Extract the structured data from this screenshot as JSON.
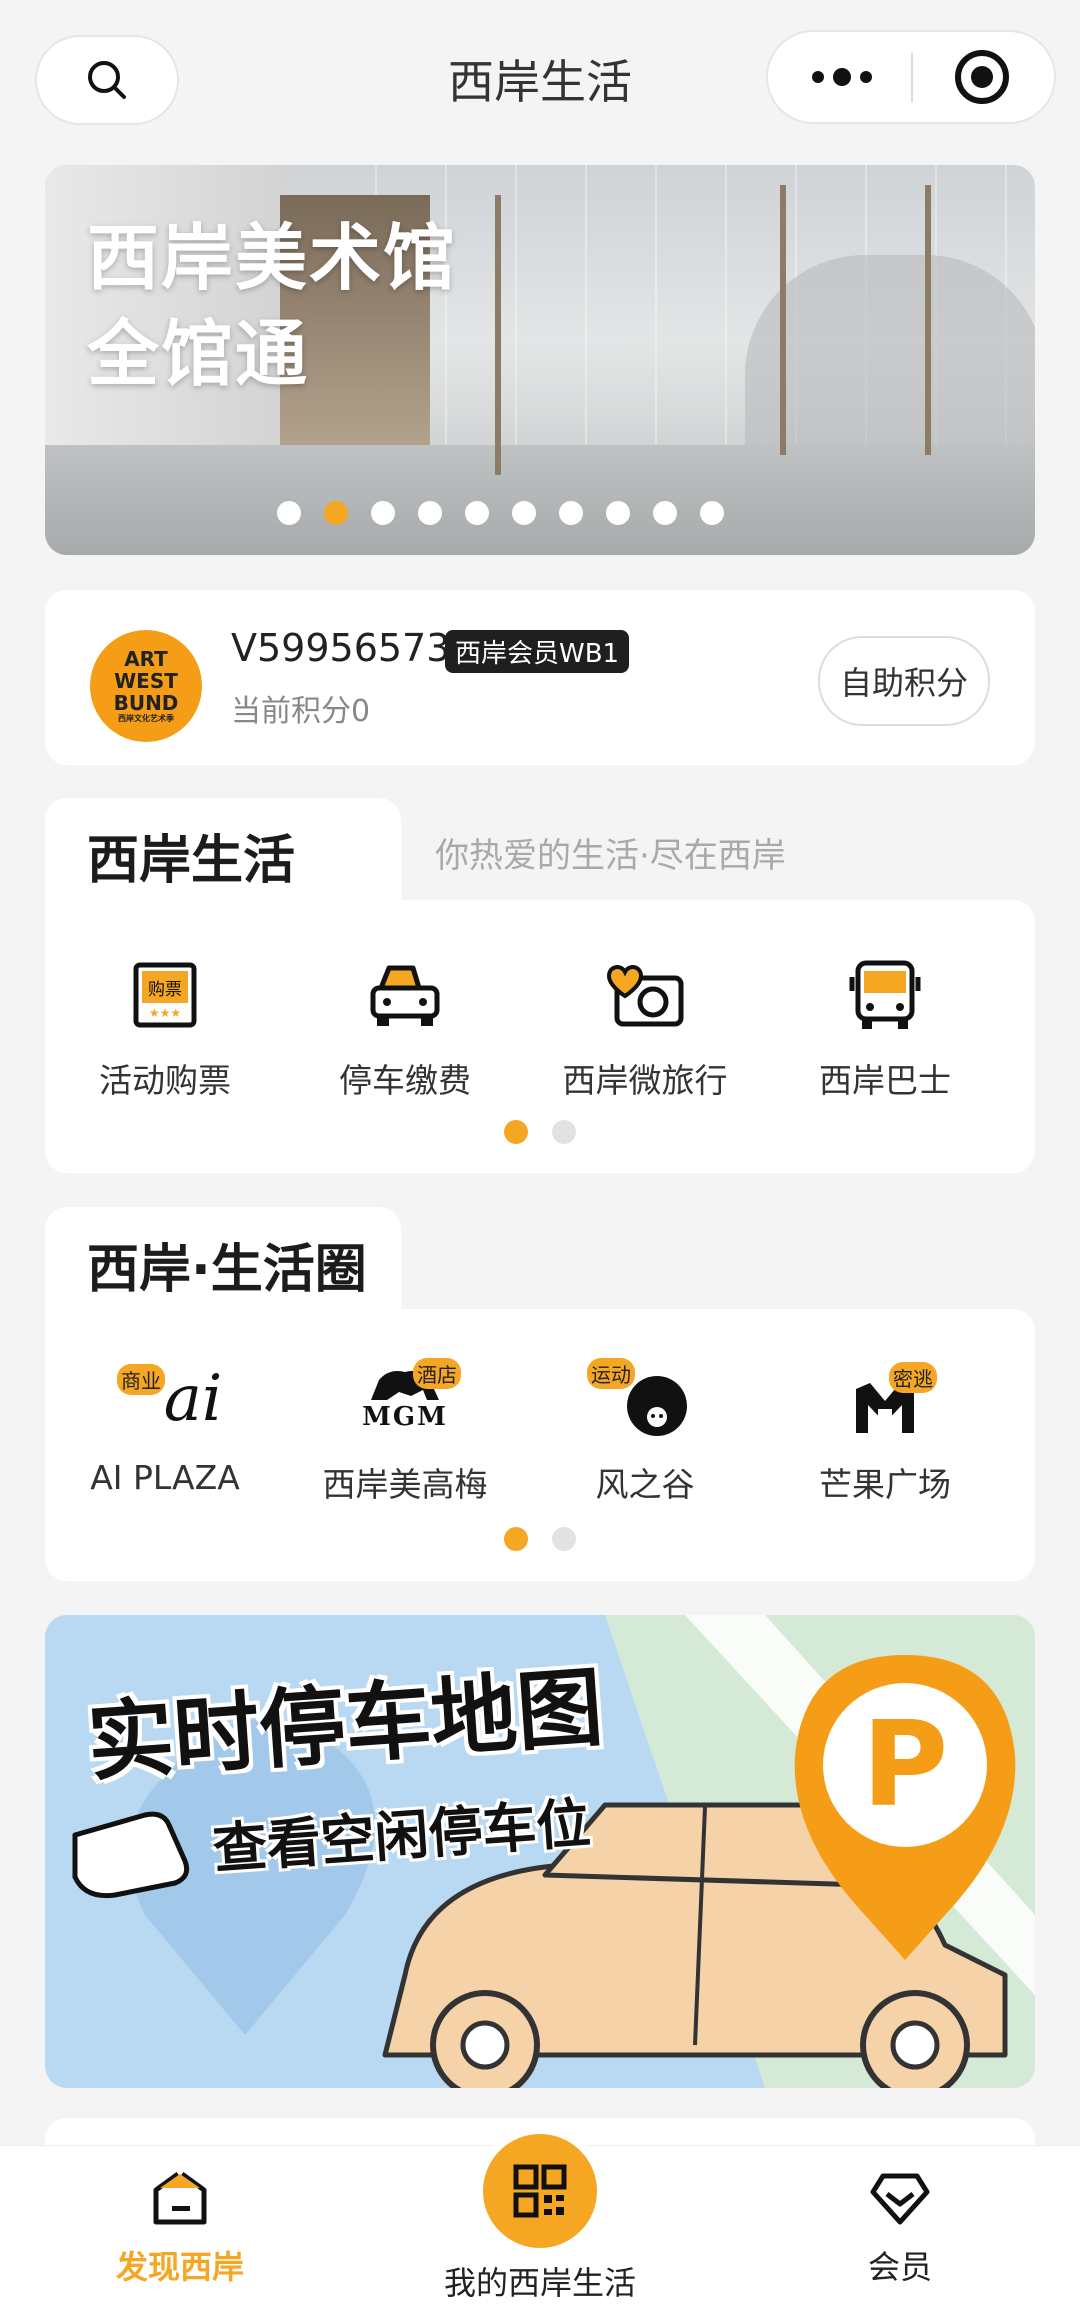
{
  "header": {
    "title": "西岸生活"
  },
  "banner": {
    "line1": "西岸美术馆",
    "line2": "全馆通",
    "slides": [
      0,
      1,
      2,
      3,
      4,
      5,
      6,
      7,
      8,
      9
    ],
    "active_slide": 1
  },
  "member": {
    "logo_lines": [
      "ART",
      "WEST",
      "BUND",
      "西岸文化艺术季"
    ],
    "id": "V59956573",
    "badge": "西岸会员WB1",
    "points": "当前积分0",
    "action": "自助积分"
  },
  "life": {
    "title": "西岸生活",
    "subtitle": "你热爱的生活·尽在西岸",
    "items": [
      {
        "label": "活动购票",
        "icon": "ticket-icon",
        "icon_text": "购票"
      },
      {
        "label": "停车缴费",
        "icon": "car-icon"
      },
      {
        "label": "西岸微旅行",
        "icon": "camera-heart-icon"
      },
      {
        "label": "西岸巴士",
        "icon": "bus-icon"
      }
    ],
    "pages": 2,
    "active_page": 0
  },
  "circle": {
    "title": "西岸·生活圈",
    "items": [
      {
        "label": "AI PLAZA",
        "tag": "商业",
        "logo_text": "ai"
      },
      {
        "label": "西岸美高梅",
        "tag": "酒店",
        "logo_text": "MGM"
      },
      {
        "label": "风之谷",
        "tag": "运动",
        "logo_text": ""
      },
      {
        "label": "芒果广场",
        "tag": "密逃",
        "logo_text": "M"
      }
    ],
    "pages": 2,
    "active_page": 0
  },
  "parking": {
    "title": "实时停车地图",
    "subtitle": "查看空闲停车位",
    "pin_letter": "P"
  },
  "tabbar": {
    "discover": "发现西岸",
    "my_life": "我的西岸生活",
    "member": "会员"
  },
  "colors": {
    "accent": "#f5a623",
    "text": "#222222",
    "muted": "#a9a9a9"
  }
}
